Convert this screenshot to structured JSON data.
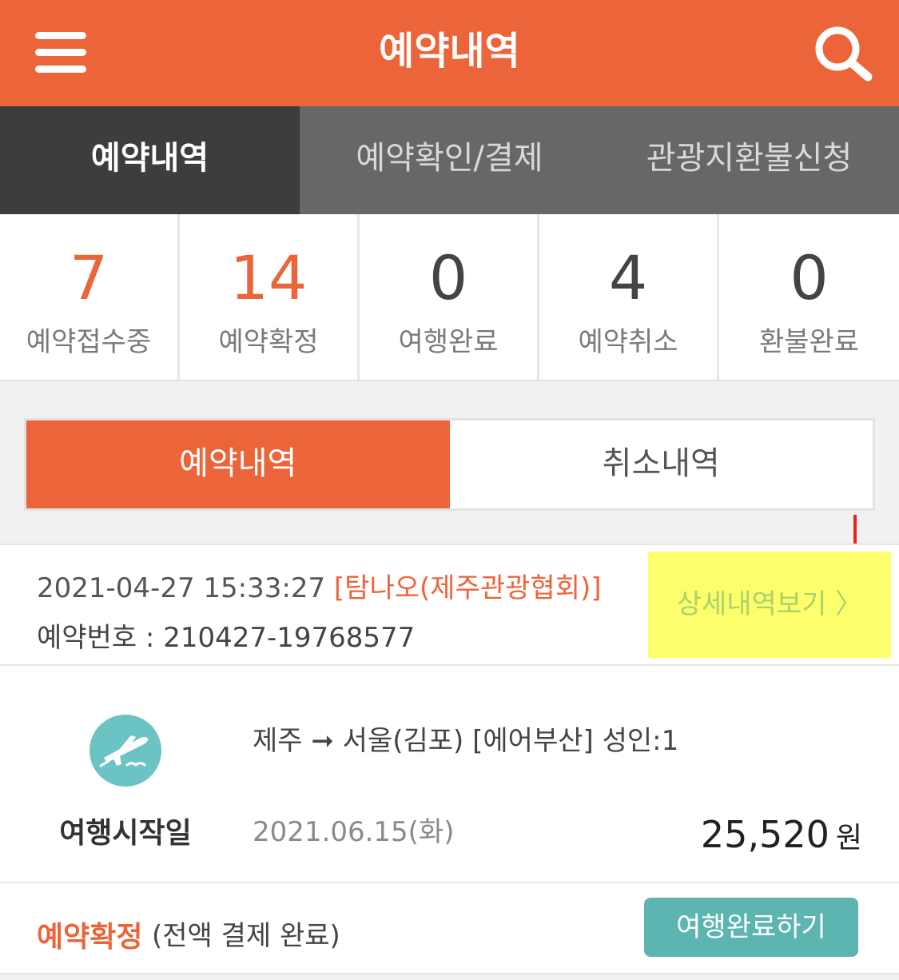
{
  "header": {
    "title": "예약내역",
    "menu_icon": "hamburger-icon",
    "search_icon": "search-icon",
    "bg_color": "#ec6439"
  },
  "tabs": [
    {
      "label": "예약내역",
      "active": true
    },
    {
      "label": "예약확인/결제",
      "active": false
    },
    {
      "label": "관광지환불신청",
      "active": false
    }
  ],
  "stats": [
    {
      "count": "7",
      "label": "예약접수중"
    },
    {
      "count": "14",
      "label": "예약확정"
    },
    {
      "count": "0",
      "label": "여행완료"
    },
    {
      "count": "4",
      "label": "예약취소"
    },
    {
      "count": "0",
      "label": "환불완료"
    }
  ],
  "toggle": {
    "reservations_label": "예약내역",
    "cancellations_label": "취소내역"
  },
  "booking": {
    "datetime": "2021-04-27 15:33:27",
    "agency": "[탐나오(제주관광협회)]",
    "number_line": "예약번호 : 210427-19768577",
    "detail_link": "상세내역보기 〉",
    "icon": "airplane-icon",
    "route": "제주 ➞ 서울(김포) [에어부산] 성인:1",
    "start_label": "여행시작일",
    "start_date": "2021.06.15(화)",
    "price": "25,520",
    "currency": "원",
    "status": "예약확정",
    "status_detail": "(전액 결제 완료)",
    "complete_button": "여행완료하기"
  },
  "colors": {
    "accent": "#ec6439",
    "highlight": "#feff6c",
    "teal": "#5db5b1",
    "arrow": "#e8231b"
  }
}
